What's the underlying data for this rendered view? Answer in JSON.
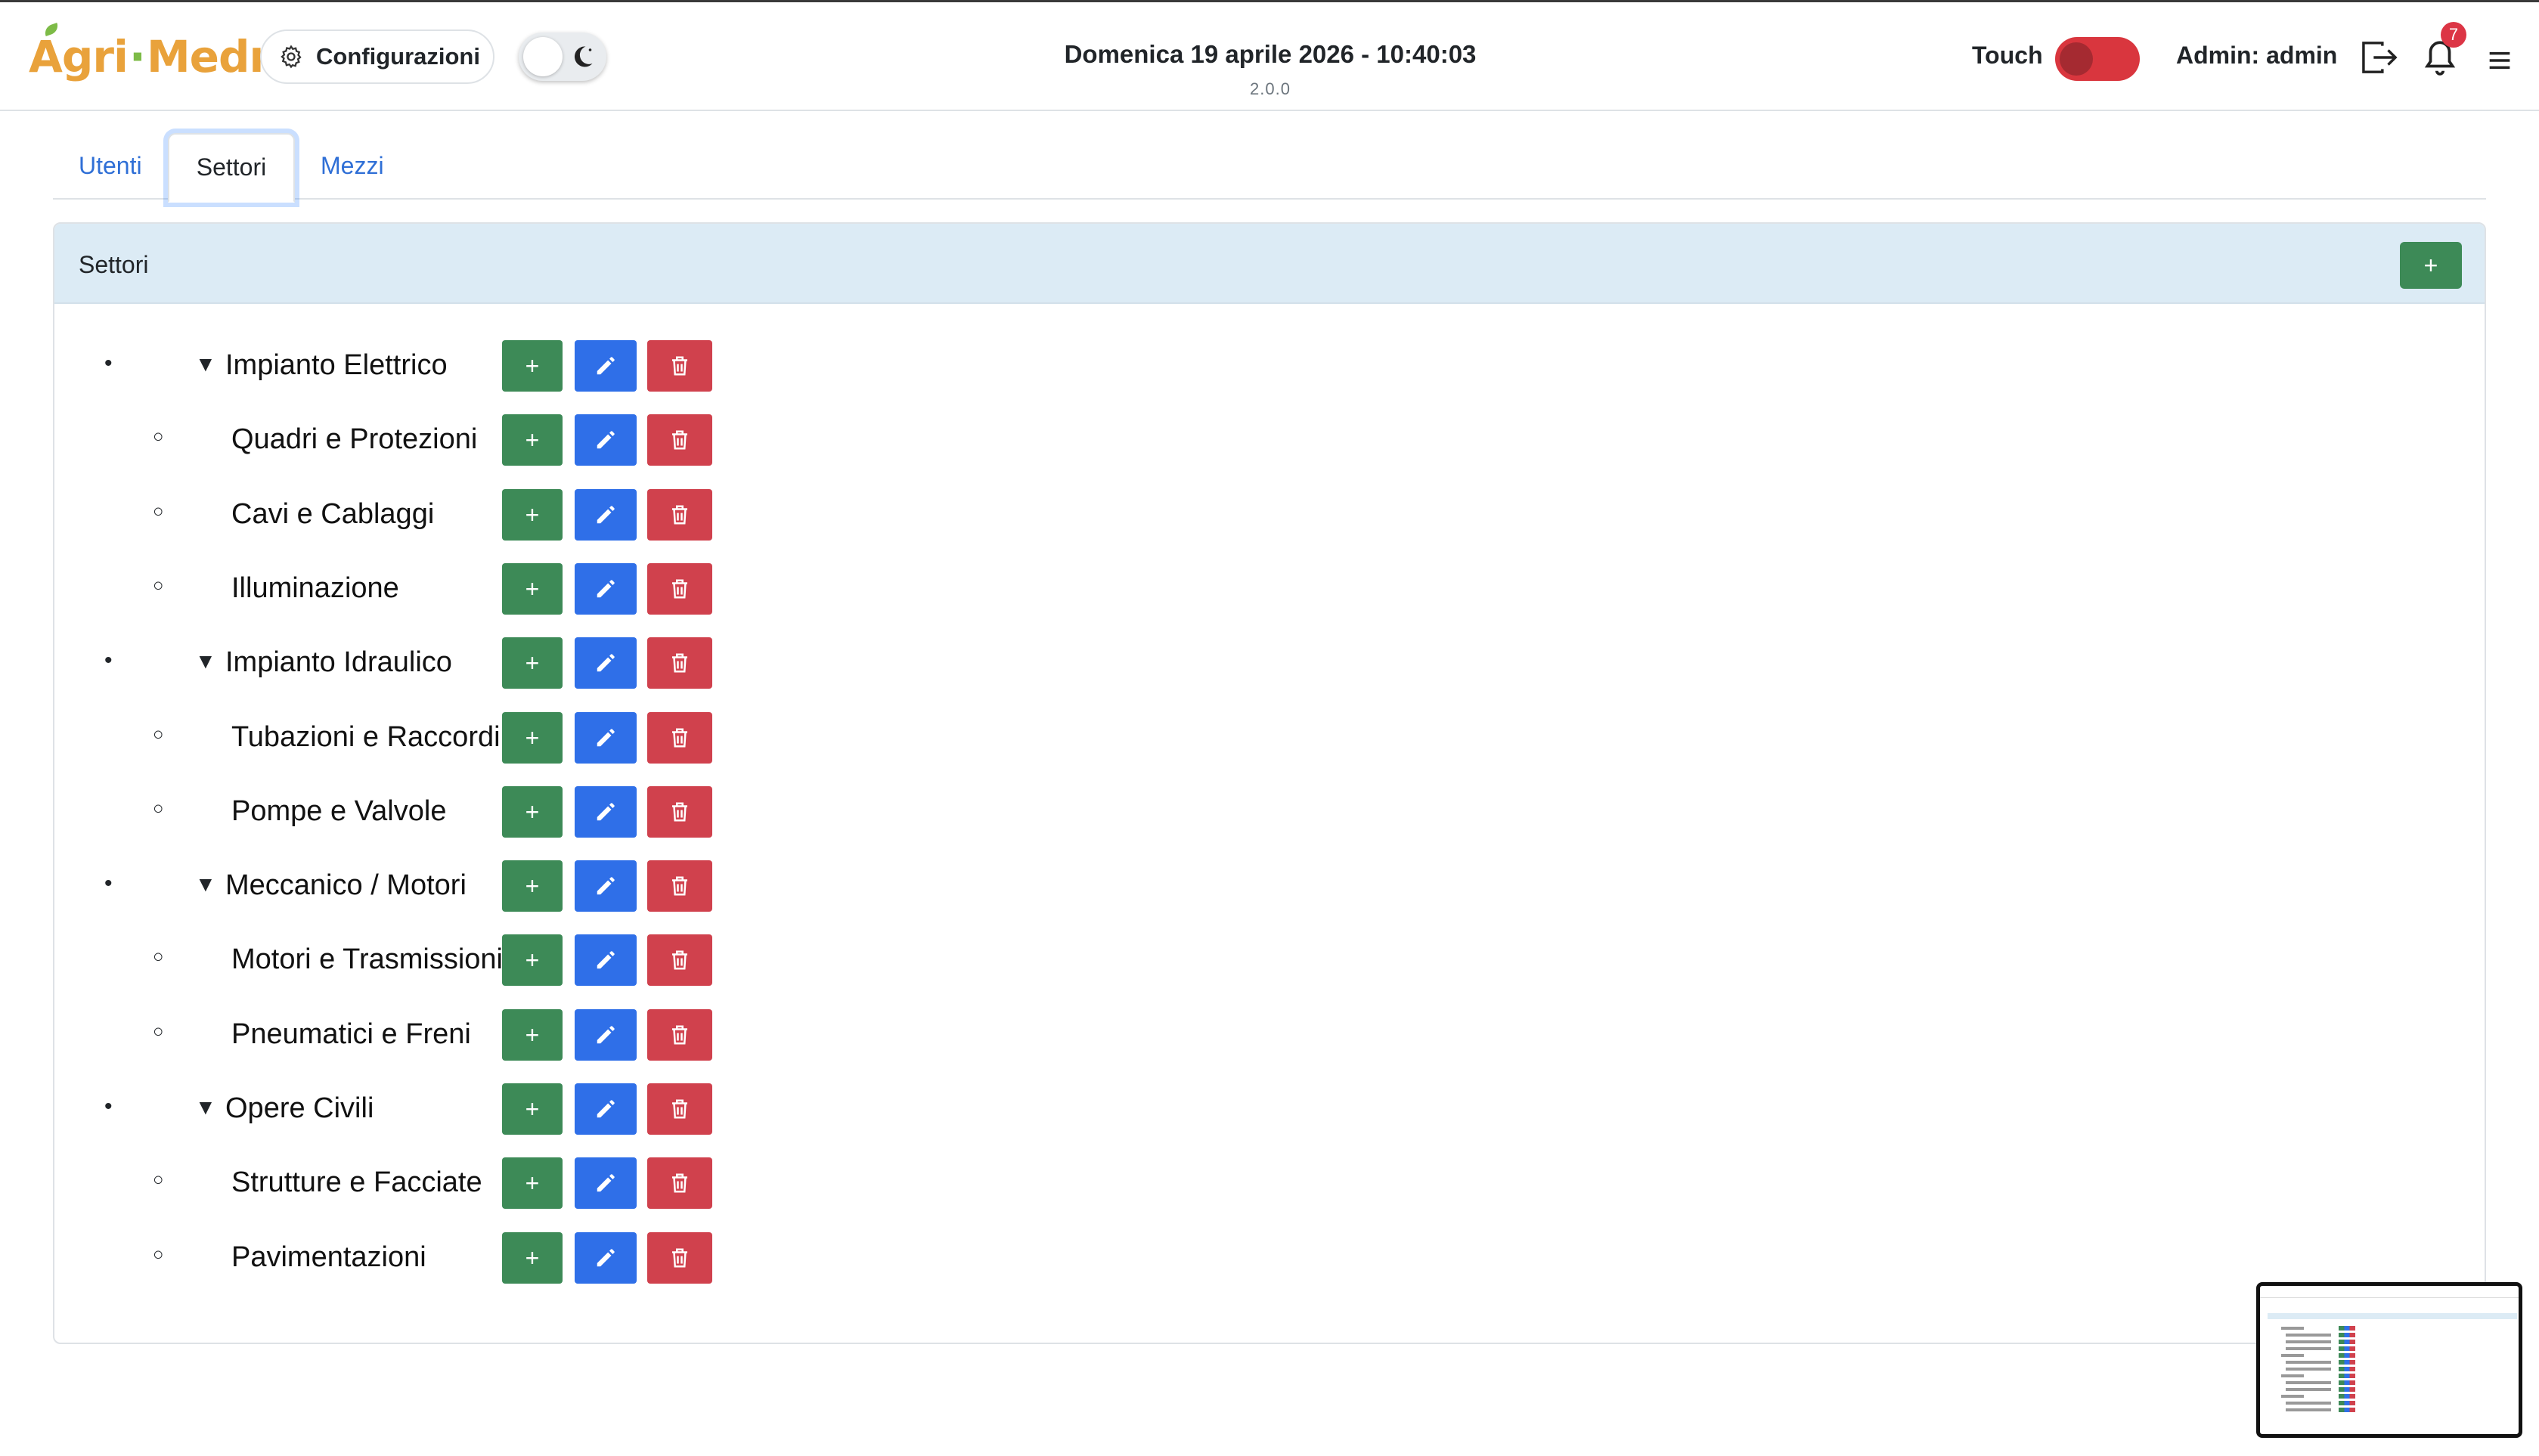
{
  "header": {
    "logo_text": [
      "Agri",
      "·",
      "Medma"
    ],
    "config_label": "Configurazioni",
    "clock": "Domenica 19 aprile 2026 - 10:40:03",
    "version": "2.0.0",
    "touch_label": "Touch",
    "admin_label": "Admin: admin",
    "notification_count": "7",
    "icons": {
      "config": "gear-icon",
      "theme": "moon-icon",
      "logout": "logout-icon",
      "bell": "bell-icon",
      "menu": "hamburger-icon"
    }
  },
  "tabs": [
    {
      "label": "Utenti",
      "active": false
    },
    {
      "label": "Settori",
      "active": true
    },
    {
      "label": "Mezzi",
      "active": false
    }
  ],
  "card": {
    "title": "Settori",
    "add_label": "+"
  },
  "buttons": {
    "add": "+",
    "edit_icon": "pencil-icon",
    "delete_icon": "trash-icon"
  },
  "sectors": [
    {
      "name": "Impianto Elettrico",
      "children": [
        "Quadri e Protezioni",
        "Cavi e Cablaggi",
        "Illuminazione"
      ]
    },
    {
      "name": "Impianto Idraulico",
      "children": [
        "Tubazioni e Raccordi",
        "Pompe e Valvole"
      ]
    },
    {
      "name": "Meccanico / Motori",
      "children": [
        "Motori e Trasmissioni",
        "Pneumatici e Freni"
      ]
    },
    {
      "name": "Opere Civili",
      "children": [
        "Strutture e Facciate",
        "Pavimentazioni"
      ]
    }
  ],
  "colors": {
    "brand_orange": "#e9a23b",
    "brand_green": "#7dbb47",
    "success": "#3d8a57",
    "primary": "#2f6fe8",
    "danger": "#d0414d",
    "card_header": "#dcebf5"
  }
}
